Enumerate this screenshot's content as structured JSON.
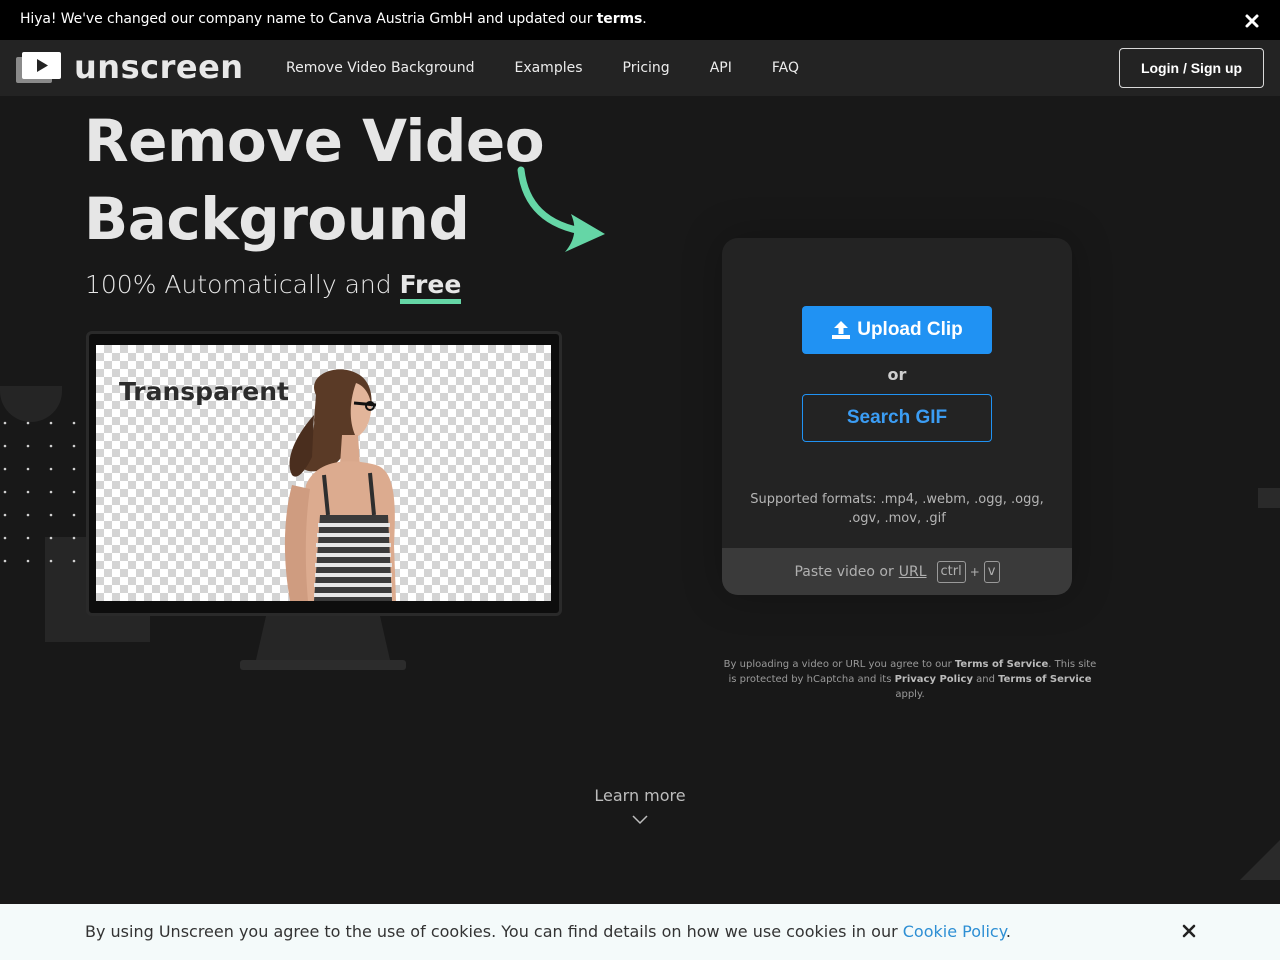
{
  "announcement": {
    "text_before": "Hiya! We've changed our company name to Canva Austria GmbH and updated our ",
    "link": "terms",
    "text_after": "."
  },
  "header": {
    "logo_text": "unscreen",
    "nav": [
      "Remove Video Background",
      "Examples",
      "Pricing",
      "API",
      "FAQ"
    ],
    "login_label": "Login / Sign up"
  },
  "hero": {
    "title_line1": "Remove Video",
    "title_line2": "Background",
    "subtitle_before": "100% Automatically and ",
    "subtitle_emphasis": "Free",
    "preview_label": "Transparent"
  },
  "upload": {
    "upload_label": "Upload Clip",
    "or_label": "or",
    "search_label": "Search GIF",
    "formats": "Supported formats: .mp4, .webm, .ogg, .ogg, .ogv, .mov, .gif",
    "paste_before": "Paste video or ",
    "paste_url": "URL",
    "key_ctrl": "ctrl",
    "key_plus": "+",
    "key_v": "v"
  },
  "terms": {
    "t1": "By uploading a video or URL you agree to our ",
    "tos1": "Terms of Service",
    "t2": ". This site is protected by hCaptcha and its ",
    "privacy": "Privacy Policy",
    "t3": " and ",
    "tos2": "Terms of Service",
    "t4": " apply."
  },
  "learn_more": "Learn more",
  "cookie": {
    "text": "By using Unscreen you agree to the use of cookies. You can find details on how we use cookies in our ",
    "link": "Cookie Policy",
    "after": "."
  },
  "colors": {
    "accent_blue": "#2092f3",
    "accent_green": "#65d6a6",
    "background": "#181818"
  }
}
